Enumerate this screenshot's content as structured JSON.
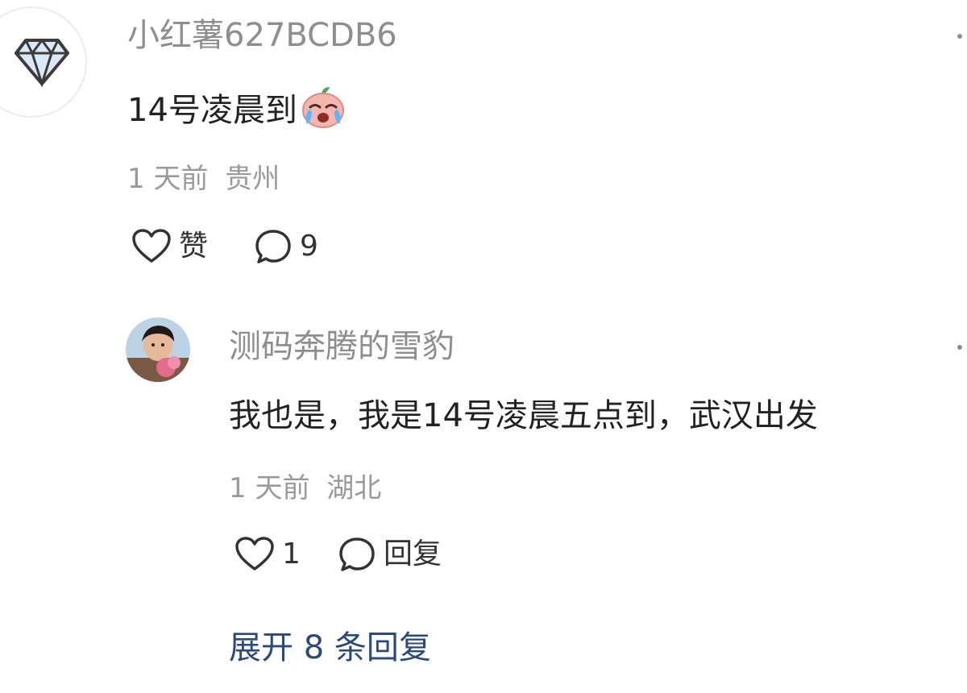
{
  "comment": {
    "username": "小红薯627BCDB6",
    "text": "14号凌晨到",
    "emoji": "crying-face-emoji",
    "time": "1 天前",
    "location": "贵州",
    "like_label": "赞",
    "reply_count": "9"
  },
  "reply": {
    "username": "测码奔腾的雪豹",
    "text": "我也是，我是14号凌晨五点到，武汉出发",
    "time": "1 天前",
    "location": "湖北",
    "like_count": "1",
    "reply_label": "回复"
  },
  "expand_label": "展开 8 条回复",
  "colors": {
    "username": "#8e8e8e",
    "meta": "#9a9a9a",
    "link": "#2b4a7a"
  }
}
